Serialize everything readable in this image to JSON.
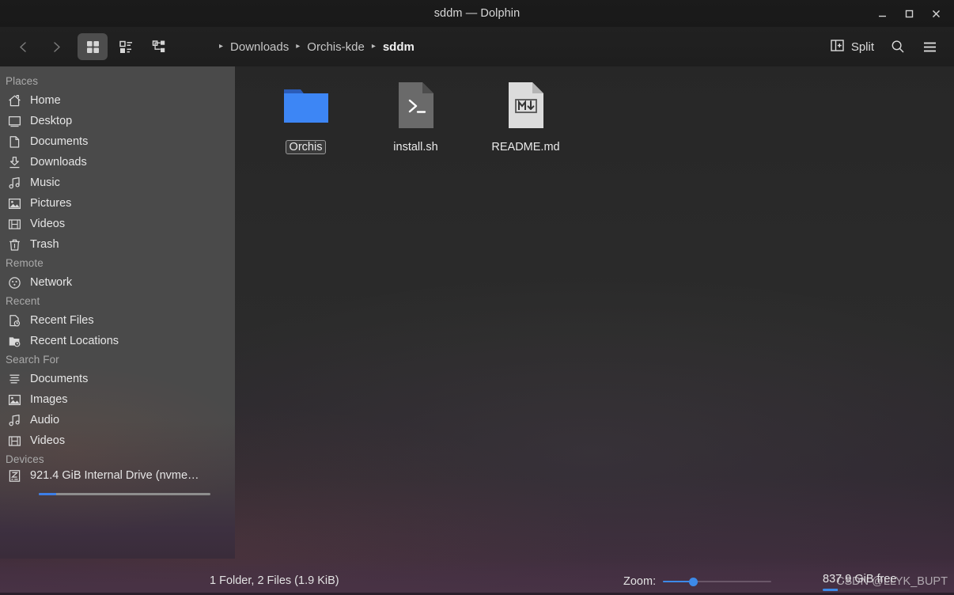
{
  "window": {
    "title": "sddm — Dolphin",
    "minimize_label": "Minimize",
    "maximize_label": "Maximize",
    "close_label": "Close"
  },
  "toolbar": {
    "back_label": "Back",
    "forward_label": "Forward",
    "view_modes": [
      {
        "name": "icons",
        "label": "Icons",
        "active": true
      },
      {
        "name": "compact",
        "label": "Compact",
        "active": false
      },
      {
        "name": "details",
        "label": "Details",
        "active": false
      }
    ],
    "split_label": "Split",
    "search_label": "Search",
    "menu_label": "Menu"
  },
  "breadcrumb": {
    "items": [
      {
        "label": "Downloads",
        "current": false
      },
      {
        "label": "Orchis-kde",
        "current": false
      },
      {
        "label": "sddm",
        "current": true
      }
    ],
    "separator": "▸"
  },
  "sidebar": {
    "sections": [
      {
        "title": "Places",
        "items": [
          {
            "label": "Home",
            "icon": "home-icon"
          },
          {
            "label": "Desktop",
            "icon": "desktop-icon"
          },
          {
            "label": "Documents",
            "icon": "document-icon"
          },
          {
            "label": "Downloads",
            "icon": "download-icon"
          },
          {
            "label": "Music",
            "icon": "music-icon"
          },
          {
            "label": "Pictures",
            "icon": "picture-icon"
          },
          {
            "label": "Videos",
            "icon": "video-icon"
          },
          {
            "label": "Trash",
            "icon": "trash-icon"
          }
        ]
      },
      {
        "title": "Remote",
        "items": [
          {
            "label": "Network",
            "icon": "network-icon"
          }
        ]
      },
      {
        "title": "Recent",
        "items": [
          {
            "label": "Recent Files",
            "icon": "recent-file-icon"
          },
          {
            "label": "Recent Locations",
            "icon": "recent-folder-icon"
          }
        ]
      },
      {
        "title": "Search For",
        "items": [
          {
            "label": "Documents",
            "icon": "text-lines-icon"
          },
          {
            "label": "Images",
            "icon": "picture-icon"
          },
          {
            "label": "Audio",
            "icon": "music-icon"
          },
          {
            "label": "Videos",
            "icon": "video-icon"
          }
        ]
      },
      {
        "title": "Devices",
        "items": [
          {
            "label": "921.4 GiB Internal Drive (nvme…",
            "icon": "drive-icon",
            "capacity_used_percent": 10
          }
        ]
      }
    ]
  },
  "files": [
    {
      "name": "Orchis",
      "type": "folder",
      "selected": true
    },
    {
      "name": "install.sh",
      "type": "shell-script",
      "selected": false
    },
    {
      "name": "README.md",
      "type": "markdown",
      "selected": false
    }
  ],
  "statusbar": {
    "summary": "1 Folder, 2 Files (1.9 KiB)",
    "zoom_label": "Zoom:",
    "zoom_percent": 28,
    "free_space": "837.9 GiB free",
    "free_used_percent": 17
  },
  "watermark": "CSDN @LLYK_BUPT",
  "colors": {
    "accent": "#3d8ae8",
    "sidebar_bg": "#4a4a4a",
    "folder_blue": "#3d7fe8",
    "statusbar_tint": "#482f46"
  }
}
